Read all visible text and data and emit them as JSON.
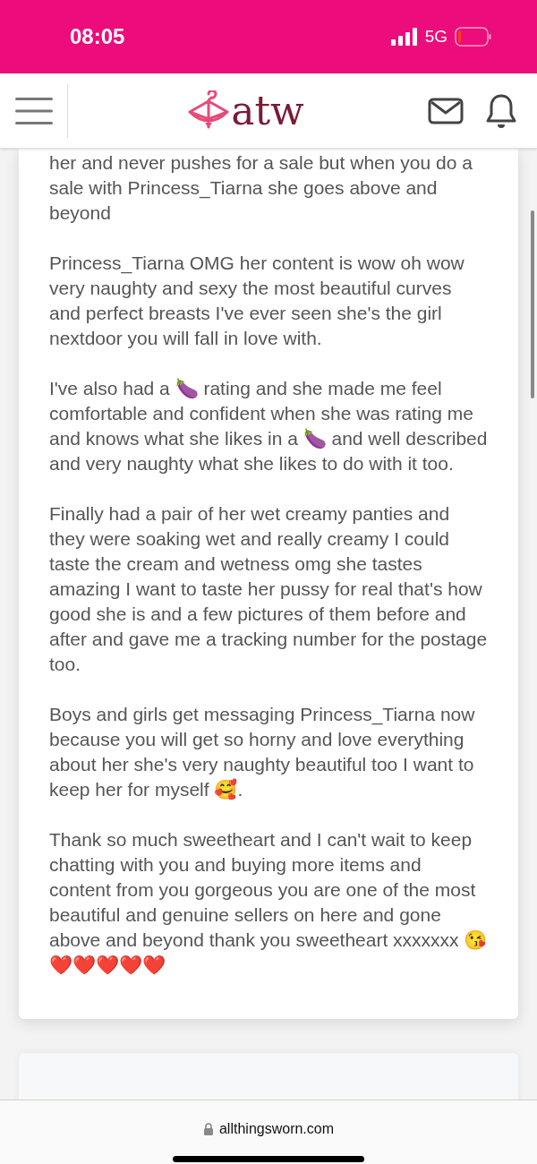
{
  "status_bar": {
    "time": "08:05",
    "network": "5G",
    "battery": {
      "level": 0.1
    }
  },
  "header": {
    "logo": "atw"
  },
  "review": {
    "paragraphs": [
      "her and never pushes for a sale but when you do a sale with Princess_Tiarna she goes above and beyond",
      "Princess_Tiarna OMG her content is wow oh wow very naughty and sexy the most beautiful curves and perfect breasts I've ever seen she's the girl nextdoor you will fall in love with.",
      "I've also had a 🍆 rating and she made me feel comfortable and confident when she was rating me and knows what she likes in a 🍆 and well described and very naughty what she likes to do with it too.",
      "Finally had a pair of her wet creamy panties and they were soaking wet and really creamy I could taste the cream and wetness omg she tastes amazing I want to taste her pussy for real that's how good she is and a few pictures of them before and after and gave me a tracking number for the postage too.",
      "Boys and girls get messaging Princess_Tiarna now because you will get so horny and love everything about her she's very naughty beautiful too I want to keep her for myself 🥰.",
      "Thank so much sweetheart and I can't wait to keep chatting with you and buying more items and content from you gorgeous you are one of the most beautiful and genuine sellers on here and gone above and beyond thank you sweetheart xxxxxxx 😘❤️❤️❤️❤️❤️"
    ]
  },
  "browser": {
    "url": "allthingsworn.com"
  }
}
